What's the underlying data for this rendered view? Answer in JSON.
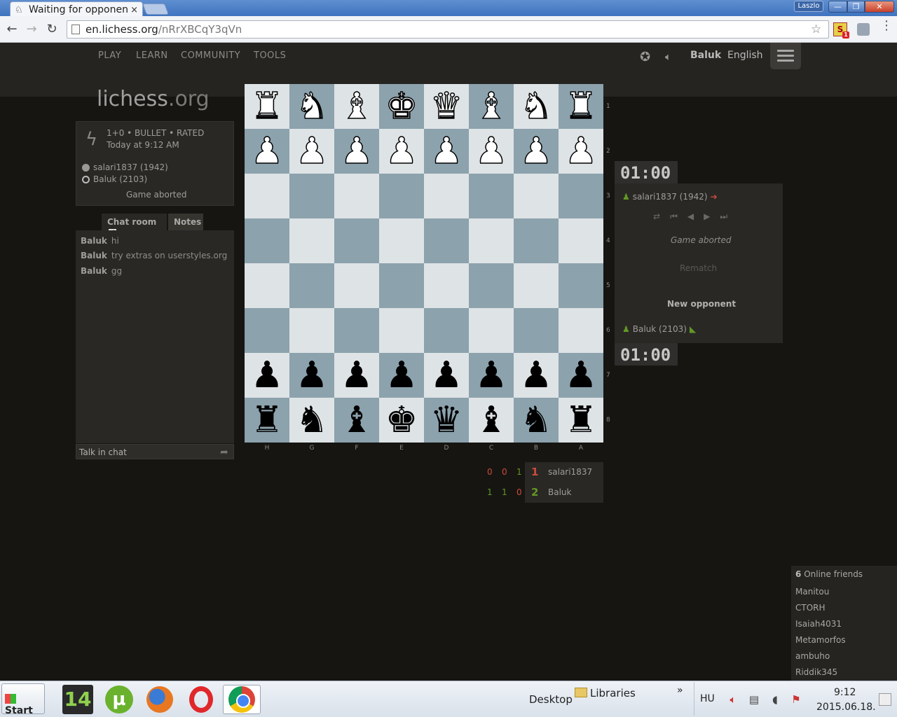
{
  "browser": {
    "tab_title": "Waiting for opponent",
    "tab_close": "×",
    "window_user": "Laszlo",
    "url_host": "en.lichess.org",
    "url_path": "/nRrXBCqY3qVn",
    "win_min": "—",
    "win_max": "❐",
    "win_close": "✕"
  },
  "nav": {
    "items": [
      "PLAY",
      "LEARN",
      "COMMUNITY",
      "TOOLS"
    ],
    "user": "Baluk",
    "language": "English"
  },
  "logo": {
    "name": "lichess",
    "tld": ".org"
  },
  "game_info": {
    "type": "1+0 • BULLET • RATED",
    "date": "Today at 9:12 AM",
    "player_black": "salari1837 (1942)",
    "player_white": "Baluk (2103)",
    "status": "Game aborted"
  },
  "chat": {
    "tab_chat": "Chat room",
    "tab_chat_check": "✓",
    "tab_notes": "Notes",
    "messages": [
      {
        "user": "Baluk",
        "text": "hi"
      },
      {
        "user": "Baluk",
        "text": "try extras on userstyles.org"
      },
      {
        "user": "Baluk",
        "text": "gg"
      }
    ],
    "input_placeholder": "Talk in chat"
  },
  "board": {
    "squares": [
      [
        "♜w",
        "♞w",
        "♝w",
        "♚w",
        "♛w",
        "♝w",
        "♞w",
        "♜w"
      ],
      [
        "♟w",
        "♟w",
        "♟w",
        "♟w",
        "♟w",
        "♟w",
        "♟w",
        "♟w"
      ],
      [
        "",
        "",
        "",
        "",
        "",
        "",
        "",
        ""
      ],
      [
        "",
        "",
        "",
        "",
        "",
        "",
        "",
        ""
      ],
      [
        "",
        "",
        "",
        "",
        "",
        "",
        "",
        ""
      ],
      [
        "",
        "",
        "",
        "",
        "",
        "",
        "",
        ""
      ],
      [
        "♟b",
        "♟b",
        "♟b",
        "♟b",
        "♟b",
        "♟b",
        "♟b",
        "♟b"
      ],
      [
        "♜b",
        "♞b",
        "♝b",
        "♚b",
        "♛b",
        "♝b",
        "♞b",
        "♜b"
      ]
    ],
    "ranks": [
      "1",
      "2",
      "3",
      "4",
      "5",
      "6",
      "7",
      "8"
    ],
    "files": [
      "H",
      "G",
      "F",
      "E",
      "D",
      "C",
      "B",
      "A"
    ],
    "colors": {
      "light": "#dee3e6",
      "dark": "#8ca2ad"
    }
  },
  "right_panel": {
    "clock_top": "01:00",
    "clock_bottom": "01:00",
    "player_top": "salari1837 (1942)",
    "player_bottom": "Baluk (2103)",
    "status": "Game aborted",
    "rematch": "Rematch",
    "new_opponent": "New opponent"
  },
  "crosstable": {
    "rows": [
      {
        "scores": [
          "0",
          "0",
          "1"
        ],
        "colors": [
          "red",
          "red",
          "green"
        ],
        "total": "1",
        "total_color": "red",
        "name": "salari1837"
      },
      {
        "scores": [
          "1",
          "1",
          "0"
        ],
        "colors": [
          "green",
          "green",
          "red"
        ],
        "total": "2",
        "total_color": "green",
        "name": "Baluk"
      }
    ]
  },
  "friends": {
    "count": "6",
    "label": "Online friends",
    "names": [
      "Manitou",
      "CTORH",
      "Isaiah4031",
      "Metamorfos",
      "ambuho",
      "Riddik345"
    ]
  },
  "taskbar": {
    "start": "Start",
    "app_14": "14",
    "app_torrent": "µ",
    "desktop": "Desktop",
    "libraries": "Libraries",
    "more": "»",
    "lang": "HU",
    "time": "9:12",
    "date": "2015.06.18."
  }
}
